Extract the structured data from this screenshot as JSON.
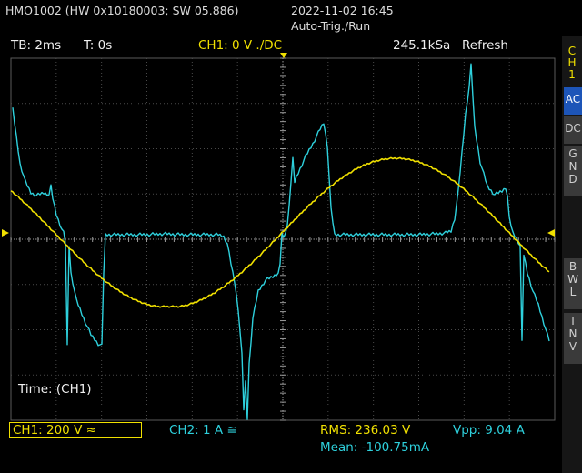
{
  "header": {
    "device": "HMO1002 (HW 0x10180003; SW 05.886)",
    "datetime": "2022-11-02 16:45",
    "trigger_mode": "Auto-Trig./Run"
  },
  "status": {
    "timebase": "TB: 2ms",
    "trigger_time": "T: 0s",
    "ch1_setting": "CH1: 0 V ./DC",
    "sample_rate": "245.1kSa",
    "mode": "Refresh"
  },
  "side_panel": {
    "channel": [
      "C",
      "H",
      "1"
    ],
    "coupling_ac": "AC",
    "coupling_dc": "DC",
    "gnd": [
      "G",
      "N",
      "D"
    ],
    "bwl": [
      "B",
      "W",
      "L"
    ],
    "inv": [
      "I",
      "N",
      "V"
    ],
    "active": "AC"
  },
  "plot": {
    "time_label": "Time: (CH1)"
  },
  "bottom": {
    "ch1_scale": "CH1: 200 V ≈",
    "ch2_scale": "CH2: 1 A ≅",
    "rms": "RMS: 236.03 V",
    "vpp": "Vpp: 9.04 A",
    "mean": "Mean: -100.75mA"
  },
  "colors": {
    "ch1": "#f0e000",
    "ch2": "#2ed0dc",
    "grid": "#5a5a5a",
    "panel_active": "#1d55b8"
  }
}
